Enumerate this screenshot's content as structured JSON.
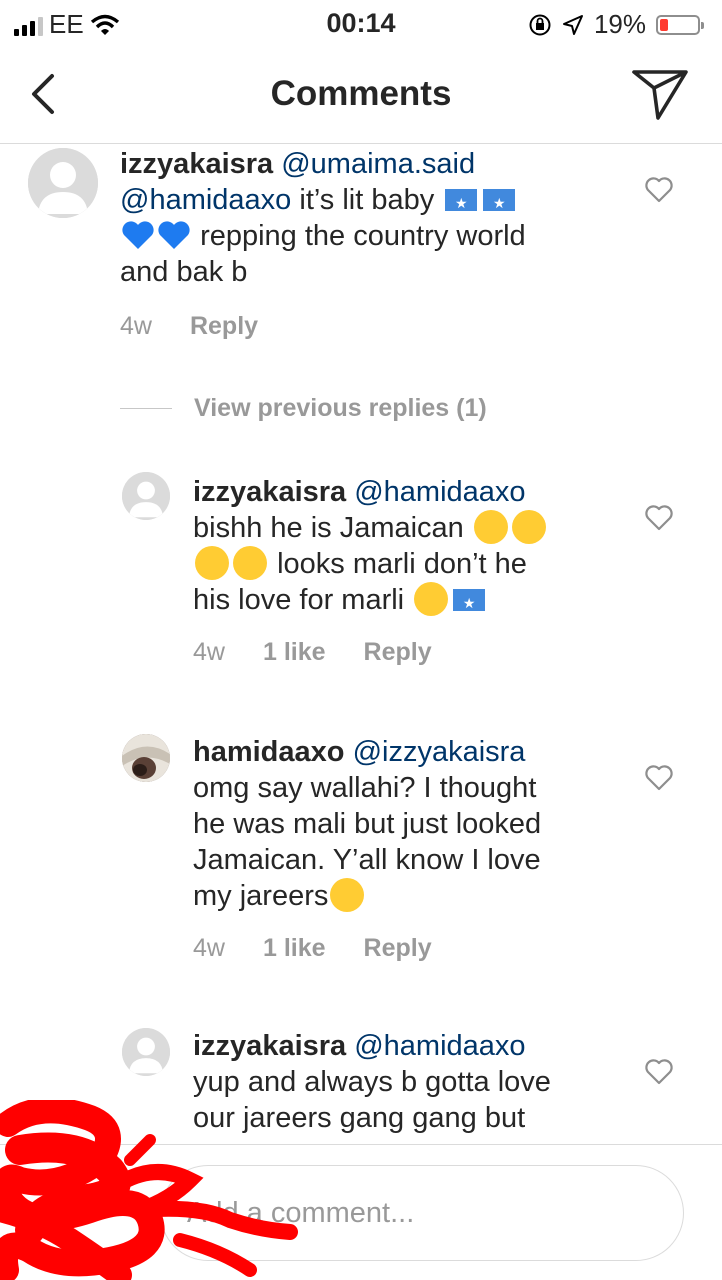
{
  "status_bar": {
    "carrier": "EE",
    "time": "00:14",
    "battery_percent": "19%",
    "battery_level": 0.19
  },
  "header": {
    "title": "Comments",
    "back_icon": "chevron-left-icon",
    "share_icon": "paper-plane-icon"
  },
  "comments": [
    {
      "username": "izzyakaisra",
      "mention": "@umaima.said",
      "mention2": "@hamidaaxo",
      "text_a": " it’s lit baby",
      "text_b": "repping the country world",
      "text_c": "and bak b",
      "time": "4w",
      "reply": "Reply"
    },
    {
      "username": "izzyakaisra",
      "mention": "@hamidaaxo",
      "text_a": "bishh he is Jamaican",
      "text_b": "looks marli don’t he",
      "text_c": "his love for marli",
      "time": "4w",
      "likes": "1 like",
      "reply": "Reply"
    },
    {
      "username": "hamidaaxo",
      "mention": "@izzyakaisra",
      "text_a": "omg say wallahi? I thought",
      "text_b": "he was mali but just looked",
      "text_c": "Jamaican. Y’all know I love",
      "text_d": "my jareers",
      "time": "4w",
      "likes": "1 like",
      "reply": "Reply"
    },
    {
      "username": "izzyakaisra",
      "mention": "@hamidaaxo",
      "text_a": "yup and always b gotta love",
      "text_b": "our jareers gang gang but"
    }
  ],
  "view_previous_replies": "View previous replies (1)",
  "comment_input": {
    "placeholder": "Add a comment..."
  },
  "colors": {
    "mention": "#003569",
    "meta": "#999999",
    "divider": "#dbdbdb",
    "redaction": "#ff0000",
    "battery_low": "#ff3b30"
  }
}
